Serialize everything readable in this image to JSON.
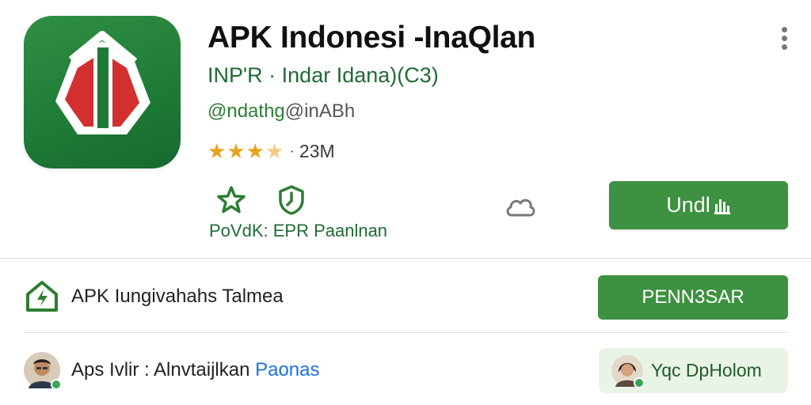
{
  "app": {
    "title": "APK Indonesi -InaQlan",
    "subtitle": "INP'R · Indar Idana)(C3)",
    "developer_primary": "@ndathg",
    "developer_secondary": "@inABh",
    "rating_stars": 3.5,
    "rating_separator": "·",
    "downloads": "23M",
    "actions_label": "PoVdK: EPR Paanlnan",
    "install_label": "Undl"
  },
  "rows": [
    {
      "text": "APK Iungivahahs Talmea",
      "button_label": "PENN3SAR"
    },
    {
      "text_prefix": "Aps Ivlir : Alnvtaijlkan",
      "text_link": "Paonas",
      "chip_label": "Yqc DpHolom"
    }
  ],
  "colors": {
    "brand_green": "#3d9140",
    "icon_green": "#2f8f43",
    "star": "#e8a21b",
    "link_blue": "#1a73e8"
  },
  "icons": [
    "app-logo-icon",
    "star-outline-icon",
    "shield-clock-icon",
    "cloud-outline-icon",
    "more-vert-icon",
    "download-bars-icon",
    "home-plus-icon"
  ]
}
